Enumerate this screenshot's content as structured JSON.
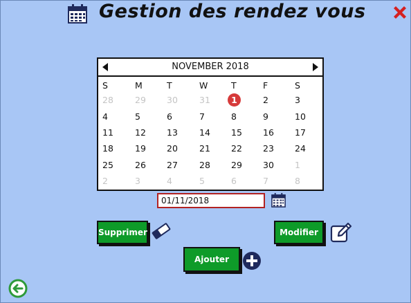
{
  "header": {
    "title": "Gestion des rendez vous",
    "title_icon": "calendar-icon",
    "close_icon": "close-icon",
    "close_color": "#d42020"
  },
  "calendar": {
    "month_label": "NOVEMBER 2018",
    "weekdays": [
      "S",
      "M",
      "T",
      "W",
      "T",
      "F",
      "S"
    ],
    "weeks": [
      [
        {
          "d": "28",
          "o": true
        },
        {
          "d": "29",
          "o": true
        },
        {
          "d": "30",
          "o": true
        },
        {
          "d": "31",
          "o": true
        },
        {
          "d": "1",
          "sel": true
        },
        {
          "d": "2"
        },
        {
          "d": "3"
        }
      ],
      [
        {
          "d": "4"
        },
        {
          "d": "5"
        },
        {
          "d": "6"
        },
        {
          "d": "7"
        },
        {
          "d": "8"
        },
        {
          "d": "9"
        },
        {
          "d": "10"
        }
      ],
      [
        {
          "d": "11"
        },
        {
          "d": "12"
        },
        {
          "d": "13"
        },
        {
          "d": "14"
        },
        {
          "d": "15"
        },
        {
          "d": "16"
        },
        {
          "d": "17"
        }
      ],
      [
        {
          "d": "18"
        },
        {
          "d": "19"
        },
        {
          "d": "20"
        },
        {
          "d": "21"
        },
        {
          "d": "22"
        },
        {
          "d": "23"
        },
        {
          "d": "24"
        }
      ],
      [
        {
          "d": "25"
        },
        {
          "d": "26"
        },
        {
          "d": "27"
        },
        {
          "d": "28"
        },
        {
          "d": "29"
        },
        {
          "d": "30"
        },
        {
          "d": "1",
          "o": true
        }
      ],
      [
        {
          "d": "2",
          "o": true
        },
        {
          "d": "3",
          "o": true
        },
        {
          "d": "4",
          "o": true
        },
        {
          "d": "5",
          "o": true
        },
        {
          "d": "6",
          "o": true
        },
        {
          "d": "7",
          "o": true
        },
        {
          "d": "8",
          "o": true
        }
      ]
    ],
    "selected_color": "#d63a3a"
  },
  "date_field": {
    "value": "01/11/2018"
  },
  "buttons": {
    "supprimer": "Supprimer",
    "modifier": "Modifier",
    "ajouter": "Ajouter"
  },
  "colors": {
    "background": "#a8c6f5",
    "button_green": "#0e9b29",
    "input_border": "#b22222",
    "back_icon": "#2e9a3a",
    "icon_navy": "#1f2a5c"
  }
}
